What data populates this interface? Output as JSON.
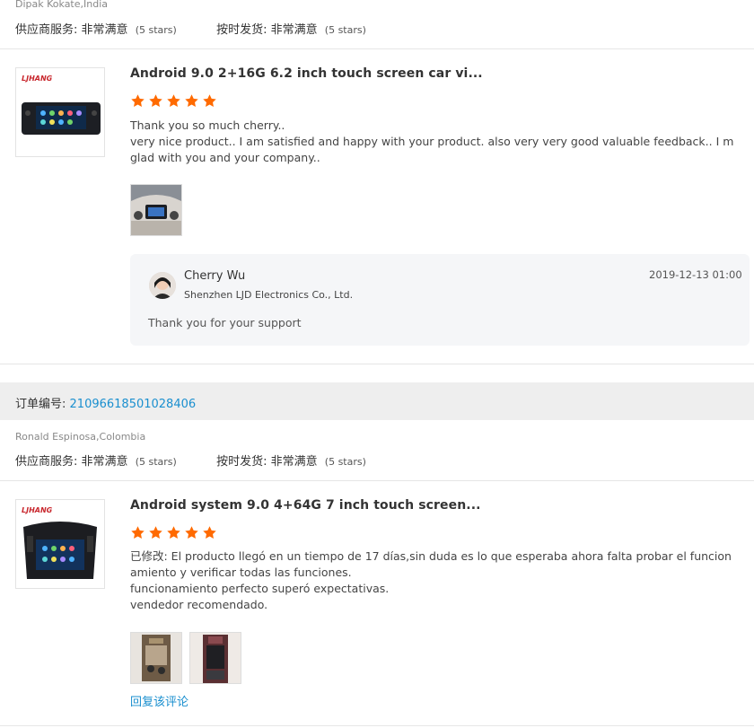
{
  "review1": {
    "reviewer": "Dipak Kokate,India",
    "supplier_service_label": "供应商服务:",
    "supplier_service_value": "非常满意",
    "supplier_service_stars": "(5 stars)",
    "ontime_label": "按时发货:",
    "ontime_value": "非常满意",
    "ontime_stars": "(5 stars)",
    "product_brand": "LJHANG",
    "product_title": "Android 9.0 2+16G 6.2 inch touch screen car vi...",
    "rating": 5,
    "text_lines": [
      "Thank you so much cherry..",
      "very nice product.. I am satisfied and happy with your product.  also very very good valuable feedback.. I m",
      "glad with you and your company.."
    ],
    "reply": {
      "name": "Cherry Wu",
      "company": "Shenzhen LJD Electronics Co., Ltd.",
      "date": "2019-12-13 01:00",
      "text": "Thank you for your support"
    }
  },
  "order": {
    "label": "订单编号:",
    "number": "21096618501028406"
  },
  "review2": {
    "reviewer": "Ronald Espinosa,Colombia",
    "supplier_service_label": "供应商服务:",
    "supplier_service_value": "非常满意",
    "supplier_service_stars": "(5 stars)",
    "ontime_label": "按时发货:",
    "ontime_value": "非常满意",
    "ontime_stars": "(5 stars)",
    "product_brand": "LJHANG",
    "product_title": "Android system 9.0 4+64G 7 inch touch screen...",
    "rating": 5,
    "text_lines": [
      "已修改: El producto llegó en un tiempo de 17 días,sin duda es lo que esperaba ahora falta probar el funcion",
      "amiento y verificar todas las funciones.",
      "funcionamiento perfecto superó expectativas.",
      "vendedor recomendado."
    ],
    "reply_link": "回复该评论"
  },
  "colors": {
    "star": "#ff6a00",
    "link": "#1a8fcf",
    "order_bar_bg": "#eeeeee",
    "reply_bg": "#f5f6f8"
  }
}
